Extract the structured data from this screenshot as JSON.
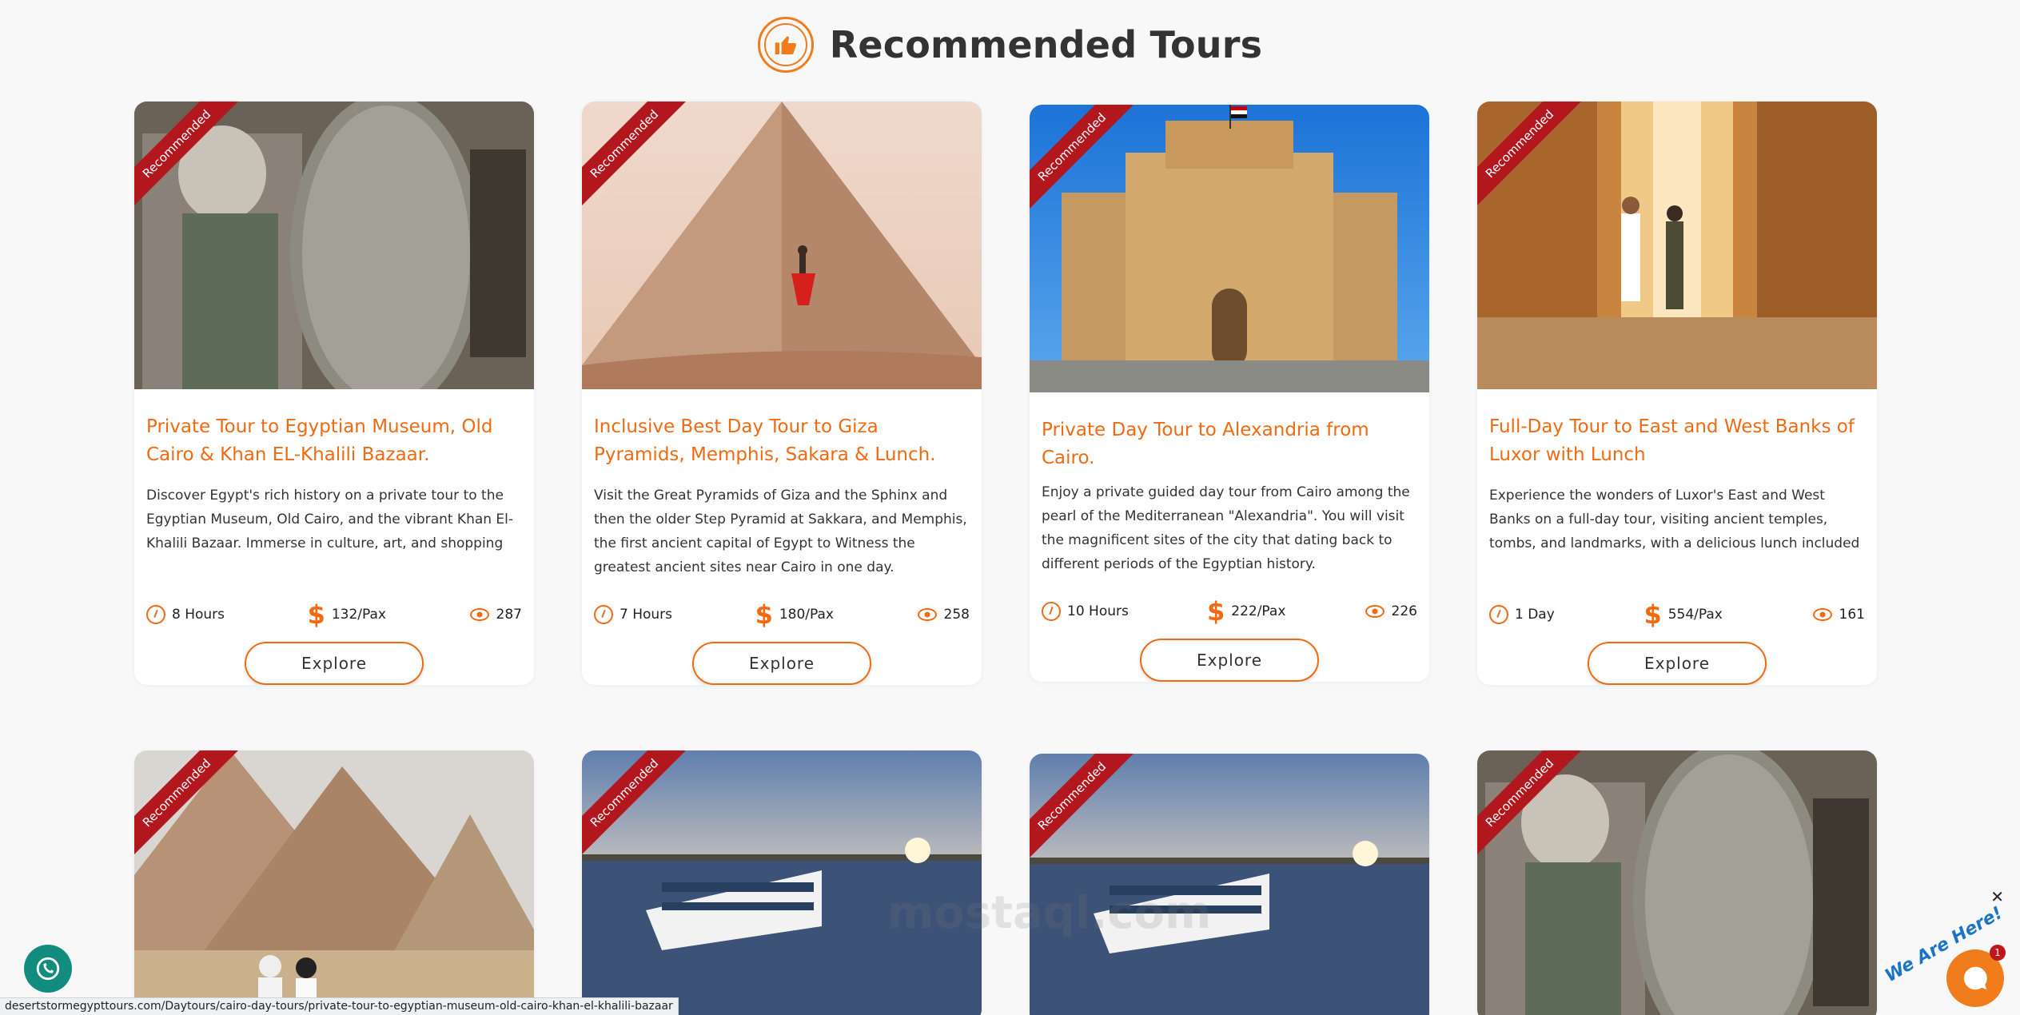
{
  "header": {
    "title": "Recommended Tours",
    "icon": "thumbs-up-icon",
    "accent": "#ef6a10"
  },
  "ribbon_label": "Recommended",
  "explore_label": "Explore",
  "cards": [
    {
      "title": "Private Tour to Egyptian Museum, Old Cairo & Khan EL-Khalili Bazaar.",
      "description": "Discover Egypt's rich history on a private tour to the Egyptian Museum, Old Cairo, and the vibrant Khan El-Khalili Bazaar. Immerse in culture, art, and shopping",
      "duration": "8 Hours",
      "price": "132/Pax",
      "views": "287"
    },
    {
      "title": "Inclusive Best Day Tour to Giza Pyramids, Memphis, Sakara & Lunch.",
      "description": "Visit the Great Pyramids of Giza and the Sphinx and then the older Step Pyramid at Sakkara, and Memphis, the first ancient capital of Egypt to Witness the greatest ancient sites near Cairo in one day.",
      "duration": "7 Hours",
      "price": "180/Pax",
      "views": "258"
    },
    {
      "title": "Private Day Tour to Alexandria from Cairo.",
      "description": "Enjoy a private guided day tour from Cairo among the pearl of the Mediterranean \"Alexandria\". You will visit the magnificent sites of the city that dating back to different periods of the Egyptian history.",
      "duration": "10 Hours",
      "price": "222/Pax",
      "views": "226"
    },
    {
      "title": "Full-Day Tour to East and West Banks of Luxor with Lunch",
      "description": "Experience the wonders of Luxor's East and West Banks on a full-day tour, visiting ancient temples, tombs, and landmarks, with a delicious lunch included",
      "duration": "1 Day",
      "price": "554/Pax",
      "views": "161"
    }
  ],
  "status_url": "desertstormegypttours.com/Daytours/cairo-day-tours/private-tour-to-egyptian-museum-old-cairo-khan-el-khalili-bazaar",
  "chat": {
    "label": "We Are Here!",
    "badge": "1",
    "close": "✕"
  },
  "watermark": "mostaql.com"
}
